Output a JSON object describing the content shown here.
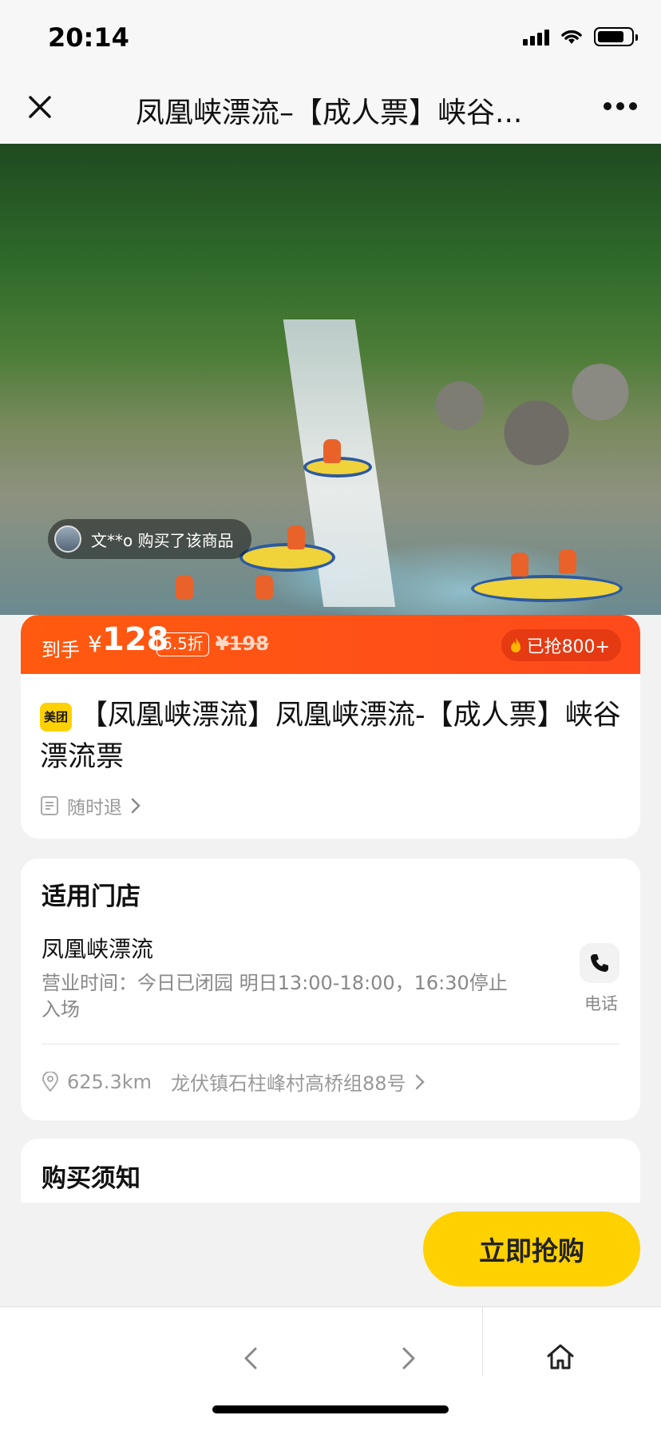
{
  "status_bar": {
    "time": "20:14"
  },
  "nav": {
    "title": "凤凰峡漂流–【成人票】峡谷..."
  },
  "hero": {
    "buyer_notice": "文**o 购买了该商品"
  },
  "price": {
    "prefix": "到手",
    "currency": "¥",
    "amount": "128",
    "discount": "6.5折",
    "original": "¥198",
    "sold": "已抢800+"
  },
  "product": {
    "brand_logo": "美团",
    "title": "【凤凰峡漂流】凤凰峡漂流-【成人票】峡谷漂流票",
    "refund": "随时退"
  },
  "store": {
    "heading": "适用门店",
    "name": "凤凰峡漂流",
    "hours": "营业时间：今日已闭园 明日13:00-18:00，16:30停止入场",
    "phone_label": "电话",
    "distance": "625.3km",
    "address": "龙伏镇石柱峰村高桥组88号"
  },
  "notice": {
    "heading": "购买须知"
  },
  "actions": {
    "buy_label": "立即抢购"
  },
  "colors": {
    "accent_orange": "#ff5a0f",
    "brand_yellow": "#ffd100"
  }
}
